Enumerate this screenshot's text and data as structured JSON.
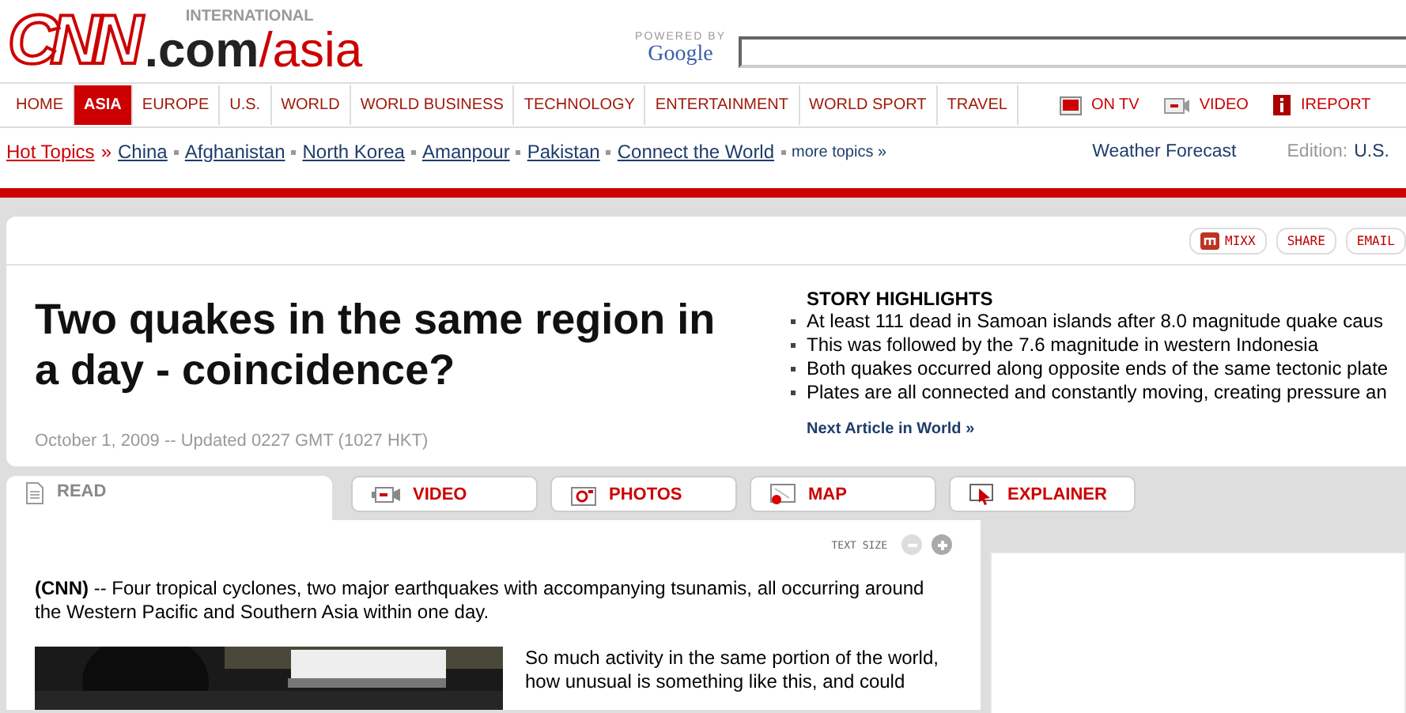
{
  "logo": {
    "brand": "CNN",
    "tag": "INTERNATIONAL",
    "domain": ".com",
    "section": "/asia"
  },
  "search": {
    "powered_by": "POWERED BY",
    "provider": "Google"
  },
  "nav": [
    {
      "label": "HOME",
      "selected": false
    },
    {
      "label": "ASIA",
      "selected": true
    },
    {
      "label": "EUROPE",
      "selected": false
    },
    {
      "label": "U.S.",
      "selected": false
    },
    {
      "label": "WORLD",
      "selected": false
    },
    {
      "label": "WORLD BUSINESS",
      "selected": false
    },
    {
      "label": "TECHNOLOGY",
      "selected": false
    },
    {
      "label": "ENTERTAINMENT",
      "selected": false
    },
    {
      "label": "WORLD SPORT",
      "selected": false
    },
    {
      "label": "TRAVEL",
      "selected": false
    }
  ],
  "nav_extra": [
    {
      "label": "ON TV",
      "kind": "tv"
    },
    {
      "label": "VIDEO",
      "kind": "video"
    },
    {
      "label": "IREPORT",
      "kind": "ireport"
    }
  ],
  "hot_topics": {
    "label": "Hot Topics",
    "arrow": "»",
    "links": [
      "China",
      "Afghanistan",
      "North Korea",
      "Amanpour",
      "Pakistan",
      "Connect the World"
    ],
    "more": "more topics »"
  },
  "weather": "Weather Forecast",
  "edition": {
    "label": "Edition:",
    "value": "U.S."
  },
  "share": [
    {
      "label": "MIXX",
      "kind": "mixx"
    },
    {
      "label": "SHARE",
      "kind": "plain"
    },
    {
      "label": "EMAIL",
      "kind": "plain"
    }
  ],
  "headline": "Two quakes in the same region in a day - coincidence?",
  "dateline": "October 1, 2009 -- Updated 0227 GMT (1027 HKT)",
  "highlights": {
    "title": "STORY HIGHLIGHTS",
    "items": [
      "At least 111 dead in Samoan islands after 8.0 magnitude quake caus",
      "This was followed by the 7.6 magnitude in western Indonesia",
      "Both quakes occurred along opposite ends of the same tectonic plate",
      "Plates are all connected and constantly moving, creating pressure an"
    ],
    "next": "Next Article in World »"
  },
  "tabs": [
    {
      "label": "READ",
      "kind": "read",
      "selected": true
    },
    {
      "label": "VIDEO",
      "kind": "video",
      "selected": false
    },
    {
      "label": "PHOTOS",
      "kind": "photos",
      "selected": false
    },
    {
      "label": "MAP",
      "kind": "map",
      "selected": false
    },
    {
      "label": "EXPLAINER",
      "kind": "explainer",
      "selected": false
    }
  ],
  "text_size": "TEXT SIZE",
  "lead": "**(CNN)** -- Four tropical cyclones, two major earthquakes with accompanying tsunamis, all occurring around the Western Pacific and Southern Asia within one day.",
  "side_paragraph": "So much activity in the same portion of the world, how unusual is something like this, and could"
}
